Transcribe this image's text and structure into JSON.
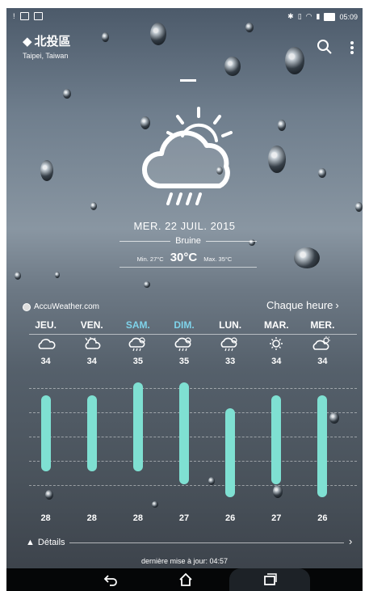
{
  "status_bar": {
    "time": "05:09"
  },
  "location": {
    "name": "北投區",
    "subtitle": "Taipei, Taiwan"
  },
  "current": {
    "date": "MER. 22 JUIL. 2015",
    "condition": "Bruine",
    "min_label": "Min. 27°C",
    "temp": "30°C",
    "max_label": "Max. 35°C"
  },
  "provider": "AccuWeather.com",
  "hourly_label": "Chaque heure",
  "forecast": [
    {
      "day": "JEU.",
      "icon": "cloud-icon",
      "high": "34",
      "low": "28",
      "highlight": false
    },
    {
      "day": "VEN.",
      "icon": "partly-cloudy-icon",
      "high": "34",
      "low": "28",
      "highlight": false
    },
    {
      "day": "SAM.",
      "icon": "cloud-sun-rain-icon",
      "high": "35",
      "low": "28",
      "highlight": true
    },
    {
      "day": "DIM.",
      "icon": "cloud-sun-rain-icon",
      "high": "35",
      "low": "27",
      "highlight": true
    },
    {
      "day": "LUN.",
      "icon": "cloud-sun-rain-icon",
      "high": "33",
      "low": "26",
      "highlight": false
    },
    {
      "day": "MAR.",
      "icon": "sun-icon",
      "high": "34",
      "low": "27",
      "highlight": false
    },
    {
      "day": "MER.",
      "icon": "cloud-sun-icon",
      "high": "34",
      "low": "26",
      "highlight": false
    }
  ],
  "details_label": "Détails",
  "last_update": "dernière mise à jour: 04:57",
  "colors": {
    "bar": "#7fe0d2",
    "highlight_day": "#7fd3ea"
  }
}
